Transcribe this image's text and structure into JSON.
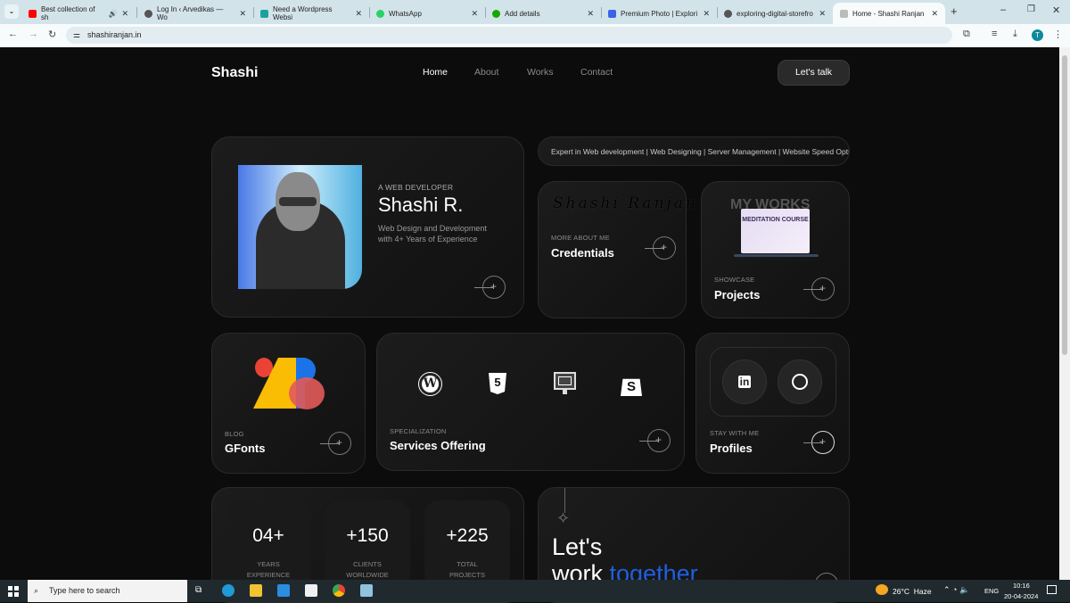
{
  "browser": {
    "tabs": [
      {
        "title": "Best collection of sh",
        "color": "#ff0000"
      },
      {
        "title": "Log In ‹ Arvedikas — Wo",
        "color": "#555555"
      },
      {
        "title": "Need a Wordpress Websi",
        "color": "#1aa39a"
      },
      {
        "title": "WhatsApp",
        "color": "#25d366"
      },
      {
        "title": "Add details",
        "color": "#14a800"
      },
      {
        "title": "Premium Photo | Explori",
        "color": "#3b63e6"
      },
      {
        "title": "exploring-digital-storefro",
        "color": "#555555"
      },
      {
        "title": "Home - Shashi Ranjan",
        "color": "#999999"
      }
    ],
    "url": "shashiranjan.in",
    "profile_initial": "T"
  },
  "site": {
    "logo": "Shashi",
    "nav": [
      "Home",
      "About",
      "Works",
      "Contact"
    ],
    "cta": "Let's talk",
    "hero": {
      "eyebrow": "A WEB DEVELOPER",
      "name": "Shashi R.",
      "line1": "Web Design and Development",
      "line2": "with 4+ Years of Experience"
    },
    "marquee": "Expert in Web development | Web Designing | Server Management | Website Speed Optimi",
    "credentials": {
      "signature": "Shashi Ranjan",
      "label": "MORE ABOUT ME",
      "title": "Credentials"
    },
    "projects": {
      "bg_text": "MY WORKS",
      "screen_text": "MEDITATION COURSE",
      "label": "SHOWCASE",
      "title": "Projects"
    },
    "blog": {
      "label": "BLOG",
      "title": "GFonts"
    },
    "services": {
      "label": "SPECIALIZATION",
      "title": "Services Offering",
      "icons": [
        "wordpress-icon",
        "html5-icon",
        "web-design-icon",
        "shopify-icon"
      ]
    },
    "profiles": {
      "label": "STAY WITH ME",
      "title": "Profiles",
      "linkedin": "in"
    },
    "stats": [
      {
        "value": "04+",
        "l1": "YEARS",
        "l2": "EXPERIENCE"
      },
      {
        "value": "+150",
        "l1": "CLIENTS",
        "l2": "WORLDWIDE"
      },
      {
        "value": "+225",
        "l1": "TOTAL",
        "l2": "PROJECTS"
      }
    ],
    "cta_card": {
      "line1": "Let's",
      "line2a": "work ",
      "line2b": "together"
    },
    "accent": "#1f5fe0"
  },
  "taskbar": {
    "search": "Type here to search",
    "weather": "26°C  Haze",
    "lang": "ENG",
    "time": "10:16",
    "date": "20-04-2024"
  }
}
